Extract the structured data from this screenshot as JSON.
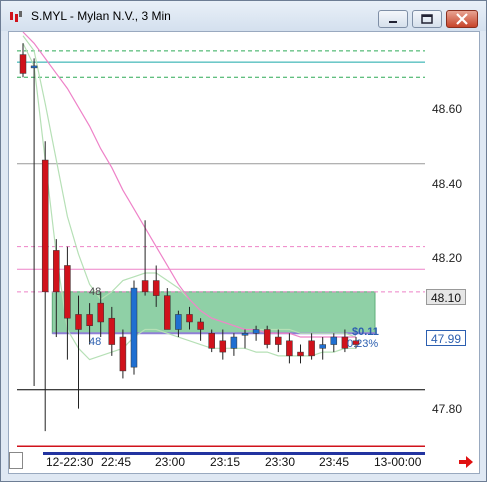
{
  "window": {
    "title": "S.MYL - Mylan N.V., 3 Min",
    "minimize": "minimize",
    "maximize": "maximize",
    "close": "close"
  },
  "colors": {
    "candle_up": "#1f6fd1",
    "candle_down": "#d0121b",
    "pink": "#ee82c8",
    "cyan": "#17a8a8",
    "green": "#2eaa57",
    "box_fill": "#8fd0a6",
    "band": "#b6e0b6"
  },
  "yaxis": {
    "labels": [
      "48.60",
      "48.40",
      "48.20",
      "47.80"
    ],
    "tag_gray": "48.10",
    "tag_blue": "47.99"
  },
  "xaxis": {
    "labels": [
      "12-22:30",
      "22:45",
      "23:00",
      "23:15",
      "23:30",
      "23:45",
      "13-00:00"
    ]
  },
  "annotations": {
    "box_left_value": "48",
    "box_left_bottom": "48",
    "pl_value": "$0.11",
    "pl_percent": "0.23%"
  },
  "chart_data": {
    "type": "candlestick",
    "title": "S.MYL - Mylan N.V., 3 Min",
    "ylim": [
      47.68,
      48.79
    ],
    "yticks": [
      47.8,
      48.2,
      48.4,
      48.6
    ],
    "categories": [
      "12-22:30",
      "22:45",
      "23:00",
      "23:15",
      "23:30",
      "23:45",
      "13-00:00"
    ],
    "candles": [
      {
        "o": 48.73,
        "h": 48.76,
        "l": 48.67,
        "c": 48.68
      },
      {
        "o": 48.7,
        "h": 48.72,
        "l": 47.85,
        "c": 48.7
      },
      {
        "o": 48.45,
        "h": 48.5,
        "l": 47.73,
        "c": 48.1
      },
      {
        "o": 48.21,
        "h": 48.24,
        "l": 47.98,
        "c": 48.1
      },
      {
        "o": 48.17,
        "h": 48.22,
        "l": 47.92,
        "c": 48.03
      },
      {
        "o": 48.04,
        "h": 48.09,
        "l": 47.79,
        "c": 48.0
      },
      {
        "o": 48.04,
        "h": 48.07,
        "l": 47.96,
        "c": 48.01
      },
      {
        "o": 48.07,
        "h": 48.1,
        "l": 47.98,
        "c": 48.02
      },
      {
        "o": 48.03,
        "h": 48.06,
        "l": 47.93,
        "c": 47.96
      },
      {
        "o": 47.98,
        "h": 48.0,
        "l": 47.87,
        "c": 47.89
      },
      {
        "o": 47.9,
        "h": 48.13,
        "l": 47.88,
        "c": 48.11
      },
      {
        "o": 48.13,
        "h": 48.29,
        "l": 48.09,
        "c": 48.1
      },
      {
        "o": 48.13,
        "h": 48.17,
        "l": 48.06,
        "c": 48.09
      },
      {
        "o": 48.09,
        "h": 48.11,
        "l": 48.0,
        "c": 48.0
      },
      {
        "o": 48.0,
        "h": 48.05,
        "l": 47.98,
        "c": 48.04
      },
      {
        "o": 48.04,
        "h": 48.06,
        "l": 48.0,
        "c": 48.02
      },
      {
        "o": 48.02,
        "h": 48.03,
        "l": 47.97,
        "c": 48.0
      },
      {
        "o": 47.99,
        "h": 48.0,
        "l": 47.94,
        "c": 47.95
      },
      {
        "o": 47.97,
        "h": 48.0,
        "l": 47.92,
        "c": 47.94
      },
      {
        "o": 47.95,
        "h": 47.99,
        "l": 47.93,
        "c": 47.98
      },
      {
        "o": 47.99,
        "h": 48.0,
        "l": 47.95,
        "c": 47.99
      },
      {
        "o": 47.99,
        "h": 48.01,
        "l": 47.97,
        "c": 48.0
      },
      {
        "o": 48.0,
        "h": 48.01,
        "l": 47.95,
        "c": 47.96
      },
      {
        "o": 47.98,
        "h": 48.0,
        "l": 47.94,
        "c": 47.96
      },
      {
        "o": 47.97,
        "h": 47.99,
        "l": 47.91,
        "c": 47.93
      },
      {
        "o": 47.94,
        "h": 47.96,
        "l": 47.91,
        "c": 47.93
      },
      {
        "o": 47.97,
        "h": 47.99,
        "l": 47.92,
        "c": 47.93
      },
      {
        "o": 47.95,
        "h": 47.98,
        "l": 47.92,
        "c": 47.96
      },
      {
        "o": 47.96,
        "h": 47.99,
        "l": 47.94,
        "c": 47.98
      },
      {
        "o": 47.98,
        "h": 48.0,
        "l": 47.94,
        "c": 47.95
      },
      {
        "o": 47.97,
        "h": 47.98,
        "l": 47.95,
        "c": 47.96
      }
    ],
    "hlines": [
      {
        "y": 48.74,
        "color": "#2eaa57",
        "style": "dashed"
      },
      {
        "y": 48.71,
        "color": "#17a8a8",
        "style": "solid"
      },
      {
        "y": 48.67,
        "color": "#2eaa57",
        "style": "dashed"
      },
      {
        "y": 48.44,
        "color": "#999999",
        "style": "solid"
      },
      {
        "y": 48.22,
        "color": "#ee82c8",
        "style": "dashed"
      },
      {
        "y": 48.16,
        "color": "#ee82c8",
        "style": "solid"
      },
      {
        "y": 48.1,
        "color": "#ee82c8",
        "style": "dashed"
      },
      {
        "y": 47.84,
        "color": "#000000",
        "style": "solid"
      },
      {
        "y": 47.69,
        "color": "#d0121b",
        "style": "solid"
      }
    ],
    "profit_box": {
      "y_top": 48.1,
      "y_bottom": 47.99
    },
    "lines": {
      "pink_ma": [
        48.79,
        48.76,
        48.72,
        48.68,
        48.64,
        48.59,
        48.54,
        48.48,
        48.43,
        48.37,
        48.32,
        48.27,
        48.22,
        48.17,
        48.12,
        48.08,
        48.05,
        48.03,
        48.02,
        48.01,
        48.0,
        48.0,
        47.99,
        47.99,
        47.99,
        47.98,
        47.98,
        47.98,
        47.98,
        47.98,
        47.98
      ],
      "band_upper": [
        48.78,
        48.74,
        48.6,
        48.45,
        48.3,
        48.2,
        48.12,
        48.08,
        48.1,
        48.13,
        48.14,
        48.15,
        48.15,
        48.13,
        48.11,
        48.08,
        48.05,
        48.03,
        48.02,
        48.01,
        48.0,
        48.0,
        48.0,
        48.0,
        48.0,
        47.99,
        47.99,
        47.99,
        47.99,
        47.99,
        47.98
      ],
      "band_lower": [
        48.76,
        48.7,
        48.45,
        48.2,
        48.0,
        47.95,
        47.92,
        47.93,
        47.94,
        47.95,
        47.98,
        48.0,
        48.0,
        47.99,
        47.98,
        47.97,
        47.96,
        47.95,
        47.95,
        47.95,
        47.95,
        47.94,
        47.94,
        47.93,
        47.93,
        47.93,
        47.93,
        47.94,
        47.94,
        47.95,
        47.95
      ]
    }
  }
}
